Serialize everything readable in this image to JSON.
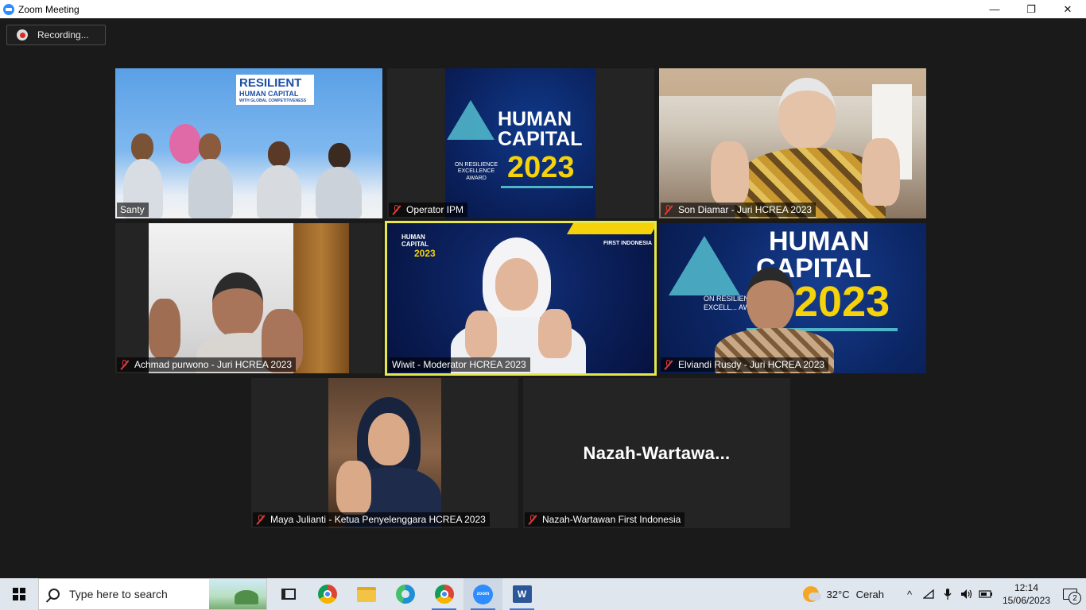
{
  "window": {
    "title": "Zoom Meeting",
    "minimize": "—",
    "restore": "❐",
    "close": "✕"
  },
  "recording": {
    "label": "Recording..."
  },
  "participants": [
    {
      "name": "Santy",
      "muted": false
    },
    {
      "name": "Operator IPM",
      "muted": true
    },
    {
      "name": "Son Diamar - Juri HCREA 2023",
      "muted": true
    },
    {
      "name": "Achmad purwono - Juri HCREA 2023",
      "muted": true
    },
    {
      "name": "Wiwit - Moderator HCREA 2023",
      "muted": false,
      "active_speaker": true
    },
    {
      "name": "Elviandi Rusdy - Juri HCREA 2023",
      "muted": true
    },
    {
      "name": "Maya Julianti - Ketua Penyelenggara HCREA 2023",
      "muted": true
    },
    {
      "name": "Nazah-Wartawan First Indonesia",
      "muted": true,
      "display_text": "Nazah-Wartawa..."
    }
  ],
  "posters": {
    "santy_banner_line1": "RESILIENT",
    "santy_banner_line2": "HUMAN CAPITAL",
    "santy_banner_line3": "WITH GLOBAL COMPETITIVENESS",
    "operator_line1": "HUMAN",
    "operator_line2": "CAPITAL",
    "operator_line3": "ON RESILIENCE EXCELLENCE AWARD",
    "operator_year": "2023",
    "wiwit_logo1": "HUMAN CAPITAL",
    "wiwit_year": "2023",
    "wiwit_brand": "FIRST INDONESIA",
    "elviandi_line1": "HUMAN",
    "elviandi_line2": "CAPITAL",
    "elviandi_line3": "ON RESILIENCE EXCELL... AW...",
    "elviandi_year": "2023"
  },
  "taskbar": {
    "search_placeholder": "Type here to search",
    "apps": [
      "task-view",
      "chrome",
      "file-explorer",
      "edge",
      "chrome-profile",
      "zoom",
      "word"
    ],
    "zoom_label": "zoom",
    "word_label": "W",
    "weather_temp": "32°C",
    "weather_condition": "Cerah",
    "tray_chevron": "^",
    "time": "12:14",
    "date": "15/06/2023",
    "notifications": "2"
  },
  "colors": {
    "active_speaker_border": "#e5e84a",
    "muted_icon": "#e03a3a",
    "zoom_blue": "#2d8cff"
  }
}
